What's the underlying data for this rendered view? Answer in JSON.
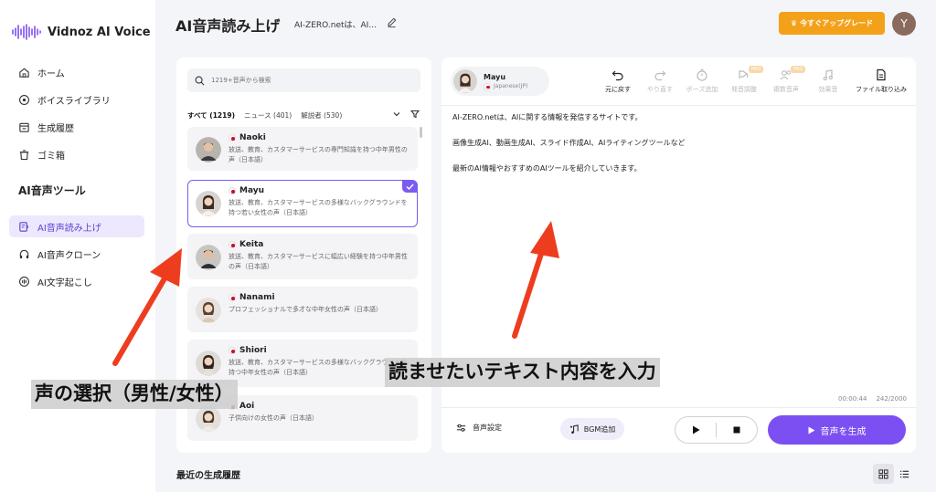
{
  "app": {
    "name": "Vidnoz AI Voice"
  },
  "sidebar": {
    "items": [
      {
        "label": "ホーム"
      },
      {
        "label": "ボイスライブラリ"
      },
      {
        "label": "生成履歴"
      },
      {
        "label": "ゴミ箱"
      }
    ],
    "section_title": "AI音声ツール",
    "tools": [
      {
        "label": "AI音声読み上げ",
        "active": true
      },
      {
        "label": "AI音声クローン"
      },
      {
        "label": "AI文字起こし"
      }
    ]
  },
  "header": {
    "title": "AI音声読み上げ",
    "doc_title": "AI-ZERO.netは、AI...",
    "upgrade_label": "今すぐアップグレード",
    "avatar_initial": "Y"
  },
  "voice_panel": {
    "search_placeholder": "1219+音声から検索",
    "filters": [
      {
        "label": "すべて (1219)",
        "active": true
      },
      {
        "label": "ニュース (401)"
      },
      {
        "label": "解説者 (530)"
      }
    ],
    "voices": [
      {
        "name": "Naoki",
        "desc": "放送、教育、カスタマーサービスの専門知識を持つ中年男性の声（日本語）"
      },
      {
        "name": "Mayu",
        "desc": "放送、教育、カスタマーサービスの多様なバックグラウンドを持つ若い女性の声（日本語）",
        "selected": true
      },
      {
        "name": "Keita",
        "desc": "放送、教育、カスタマーサービスに幅広い経験を持つ中年男性の声（日本語）"
      },
      {
        "name": "Nanami",
        "desc": "プロフェッショナルで多才な中年女性の声（日本語）"
      },
      {
        "name": "Shiori",
        "desc": "放送、教育、カスタマーサービスの多様なバックグラウンドを持つ中年女性の声（日本語）"
      },
      {
        "name": "Aoi",
        "desc": "子供向けの女性の声（日本語）"
      }
    ]
  },
  "editor": {
    "voice_name": "Mayu",
    "voice_lang": "Japanese(JP)",
    "toolbar": [
      {
        "label": "元に戻す",
        "icon": "undo-icon"
      },
      {
        "label": "やり直す",
        "icon": "redo-icon",
        "disabled": true
      },
      {
        "label": "ポーズ追加",
        "icon": "pause-timer-icon",
        "disabled": true
      },
      {
        "label": "発音調整",
        "icon": "pronunciation-icon",
        "disabled": true,
        "pro": "PRO"
      },
      {
        "label": "複数音声",
        "icon": "multi-voice-icon",
        "disabled": true,
        "pro": "PRO"
      },
      {
        "label": "効果音",
        "icon": "sound-effect-icon",
        "disabled": true
      },
      {
        "label": "ファイル取り込み",
        "icon": "file-import-icon"
      }
    ],
    "text_lines": [
      "AI-ZERO.netは、AIに関する情報を発信するサイトです。",
      "画像生成AI、動画生成AI、スライド作成AI、AIライティングツールなど",
      "最新のAI情報やおすすめのAIツールを紹介していきます。"
    ],
    "duration": "00:00:44",
    "char_count": "242/2000",
    "settings_label": "音声設定",
    "bgm_label": "BGM追加",
    "generate_label": "音声を生成"
  },
  "history": {
    "title": "最近の生成履歴"
  },
  "annotations": {
    "left": "声の選択（男性/女性）",
    "right": "読ませたいテキスト内容を入力"
  },
  "colors": {
    "accent": "#7c4ff2",
    "upgrade": "#f4a11a",
    "arrow": "#ee3d1e"
  }
}
